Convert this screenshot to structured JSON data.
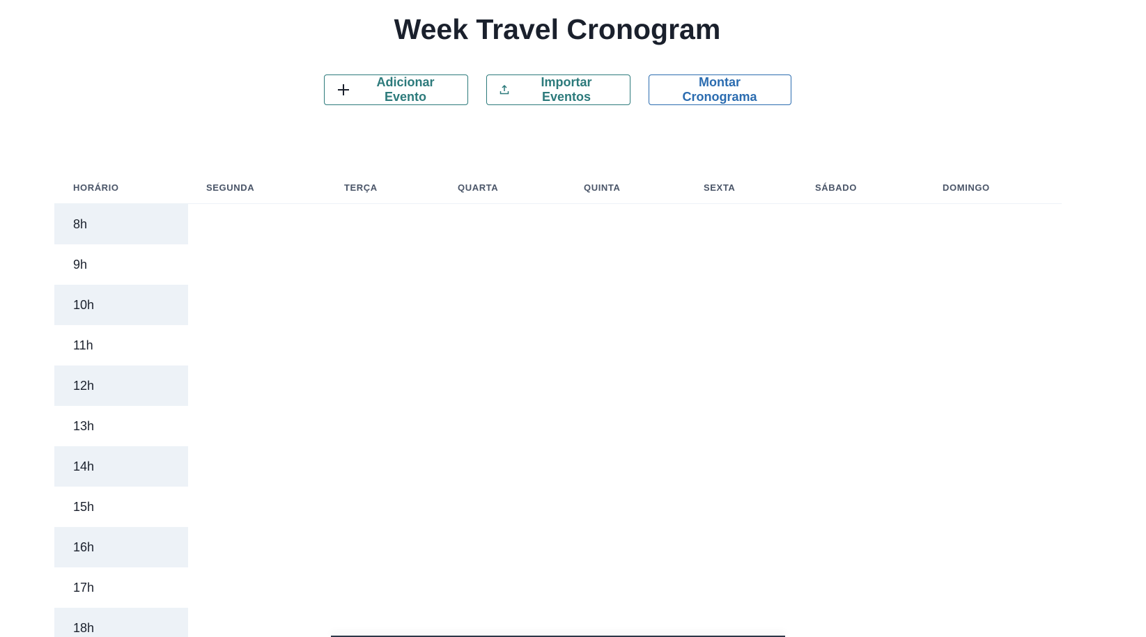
{
  "title": "Week Travel Cronogram",
  "actions": {
    "add_label": "Adicionar Evento",
    "add_icon": "plus-icon",
    "import_label": "Importar Eventos",
    "import_icon": "upload-icon",
    "build_label": "Montar Cronograma"
  },
  "table": {
    "headers": [
      "HORÁRIO",
      "SEGUNDA",
      "TERÇA",
      "QUARTA",
      "QUINTA",
      "SEXTA",
      "SÁBADO",
      "DOMINGO"
    ],
    "hours": [
      "8h",
      "9h",
      "10h",
      "11h",
      "12h",
      "13h",
      "14h",
      "15h",
      "16h",
      "17h",
      "18h"
    ]
  },
  "colors": {
    "accent_teal": "#2c7a7b",
    "accent_blue": "#2b6cb0",
    "row_shade": "#edf2f7",
    "title_text": "#1a202c"
  }
}
